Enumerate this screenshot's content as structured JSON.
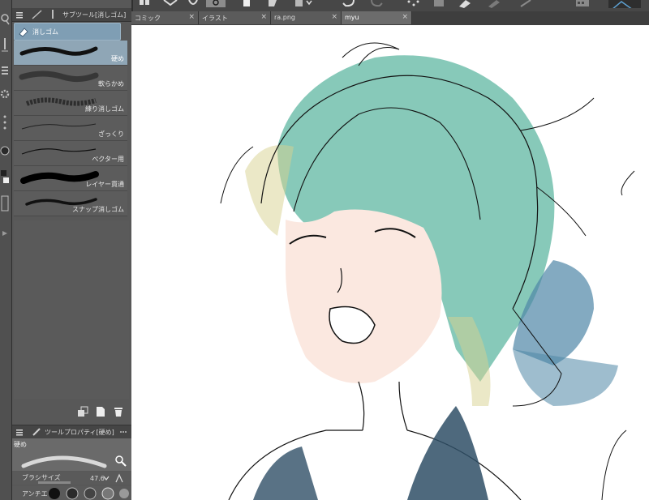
{
  "sub_tool_panel": {
    "title": "サブツール[消しゴム]",
    "group_tab": "消しゴム",
    "items": [
      {
        "label": "硬め",
        "selected": true
      },
      {
        "label": "軟らかめ",
        "selected": false
      },
      {
        "label": "練り消しゴム",
        "selected": false
      },
      {
        "label": "ざっくり",
        "selected": false
      },
      {
        "label": "ベクター用",
        "selected": false
      },
      {
        "label": "レイヤー貫通",
        "selected": false
      },
      {
        "label": "スナップ消しゴム",
        "selected": false
      }
    ]
  },
  "tool_property": {
    "title": "ツールプロパティ[硬め]",
    "preset_name": "硬め",
    "brush_size_label": "ブラシサイズ",
    "brush_size_value": "47.6",
    "antialias_label": "アンチエ"
  },
  "tabs": [
    {
      "label": "コミック",
      "active": false
    },
    {
      "label": "イラスト",
      "active": false
    },
    {
      "label": "ra.png",
      "active": false
    },
    {
      "label": "myu",
      "active": true
    }
  ],
  "colors": {
    "accent": "#8fa6b6",
    "panel": "#585858",
    "header": "#454545",
    "hair": "#5fb7a2",
    "ribbon": "#4f86a6",
    "dress": "#2f4f66",
    "skin": "#fbe8e0"
  }
}
